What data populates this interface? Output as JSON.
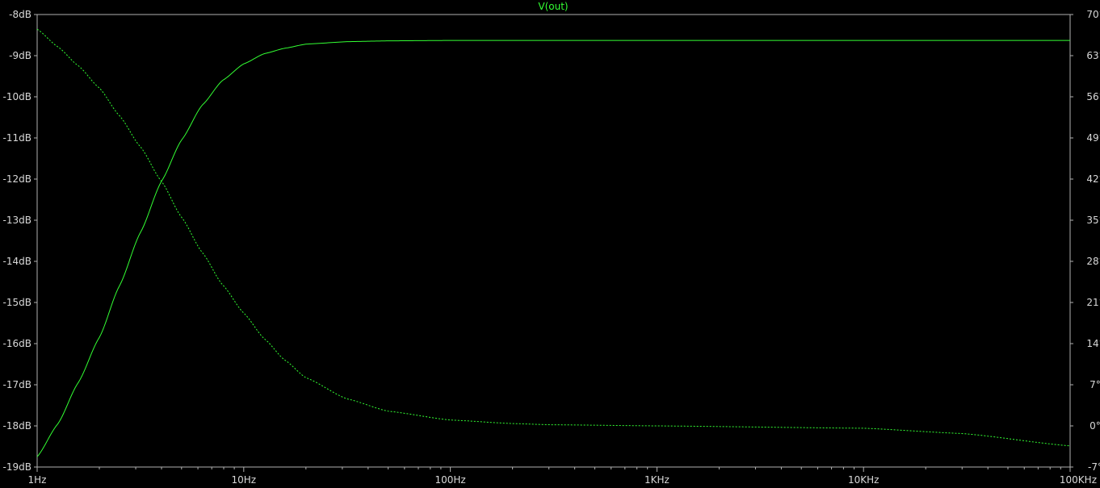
{
  "chart_data": {
    "type": "line",
    "title": "V(out)",
    "xlabel": "",
    "ylabel": "",
    "x_scale": "log",
    "xlim": [
      1,
      100000
    ],
    "ylim": [
      -19,
      -8
    ],
    "y2lim": [
      -7,
      70
    ],
    "grid": false,
    "x_tick_values": [
      1,
      10,
      100,
      1000,
      10000,
      100000
    ],
    "x_tick_labels": [
      "1Hz",
      "10Hz",
      "100Hz",
      "1KHz",
      "10KHz",
      "100KHz"
    ],
    "y_tick_values": [
      -8,
      -9,
      -10,
      -11,
      -12,
      -13,
      -14,
      -15,
      -16,
      -17,
      -18,
      -19
    ],
    "y_tick_labels": [
      "-8dB",
      "-9dB",
      "-10dB",
      "-11dB",
      "-12dB",
      "-13dB",
      "-14dB",
      "-15dB",
      "-16dB",
      "-17dB",
      "-18dB",
      "-19dB"
    ],
    "y2_tick_values": [
      70,
      63,
      56,
      49,
      42,
      35,
      28,
      21,
      14,
      7,
      0,
      -7
    ],
    "y2_tick_labels": [
      "70°",
      "63°",
      "56°",
      "49°",
      "42°",
      "35°",
      "28°",
      "21°",
      "14°",
      "7°",
      "0°",
      "-7°"
    ],
    "series": [
      {
        "name": "V(out)",
        "axis": "left",
        "style": "solid",
        "color": "#33ff33",
        "x": [
          1,
          1.26,
          1.58,
          2,
          2.5,
          3.16,
          4,
          5,
          6.3,
          7.9,
          10,
          12.6,
          15.8,
          20,
          31.6,
          50,
          100,
          1000,
          10000,
          100000
        ],
        "y": [
          -18.75,
          -17.95,
          -16.95,
          -15.85,
          -14.6,
          -13.3,
          -12.05,
          -11.05,
          -10.2,
          -9.6,
          -9.2,
          -8.95,
          -8.82,
          -8.72,
          -8.66,
          -8.64,
          -8.63,
          -8.63,
          -8.63,
          -8.63
        ]
      },
      {
        "name": "V(out) phase",
        "axis": "right",
        "style": "dashed",
        "color": "#33ff33",
        "x": [
          1,
          1.26,
          1.58,
          2,
          2.5,
          3.16,
          4,
          5,
          6.3,
          7.9,
          10,
          12.6,
          15.8,
          20,
          31.6,
          50,
          100,
          200,
          300,
          1000,
          10000,
          30000,
          100000
        ],
        "y": [
          67.5,
          64.5,
          61.3,
          57.5,
          52.8,
          47.5,
          41.6,
          35.5,
          29.5,
          24,
          19.2,
          14.8,
          11.2,
          8.2,
          4.6,
          2.5,
          1,
          0.4,
          0.2,
          0,
          -0.4,
          -1.3,
          -3.4
        ]
      }
    ]
  }
}
